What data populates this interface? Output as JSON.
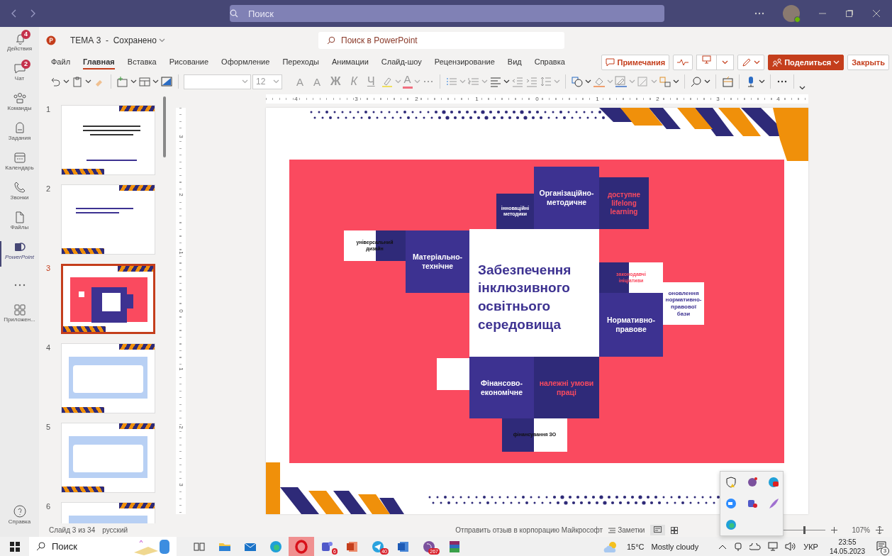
{
  "titlebar": {
    "search": {
      "placeholder": "Поиск"
    }
  },
  "rail": {
    "items": [
      {
        "label": "Действия",
        "badge": "4",
        "selected": false
      },
      {
        "label": "Чат",
        "badge": "2",
        "selected": false
      },
      {
        "label": "Команды",
        "selected": false
      },
      {
        "label": "Задания",
        "selected": false
      },
      {
        "label": "Календарь",
        "selected": false
      },
      {
        "label": "Звонки",
        "selected": false
      },
      {
        "label": "Файлы",
        "selected": false
      },
      {
        "label": "PowerPoint",
        "selected": true
      },
      {
        "label": "Приложен...",
        "selected": false
      }
    ],
    "help": "Справка"
  },
  "header": {
    "document_title": "ТЕМА 3  -  Сохранено",
    "search": {
      "placeholder": "Поиск в PowerPoint"
    }
  },
  "tabs": [
    {
      "label": "Файл",
      "selected": false
    },
    {
      "label": "Главная",
      "selected": true
    },
    {
      "label": "Вставка",
      "selected": false
    },
    {
      "label": "Рисование",
      "selected": false
    },
    {
      "label": "Оформление",
      "selected": false
    },
    {
      "label": "Переходы",
      "selected": false
    },
    {
      "label": "Анимации",
      "selected": false
    },
    {
      "label": "Слайд-шоу",
      "selected": false
    },
    {
      "label": "Рецензирование",
      "selected": false
    },
    {
      "label": "Вид",
      "selected": false
    },
    {
      "label": "Справка",
      "selected": false
    }
  ],
  "actions": {
    "comments": "Примечания",
    "share": "Поделиться",
    "close": "Закрыть"
  },
  "toolbar": {
    "font_size": "12",
    "format_buttons": [
      {
        "kind": "grow",
        "label": "A"
      },
      {
        "kind": "shrink",
        "label": "A"
      },
      {
        "kind": "bold",
        "label": "Ж"
      },
      {
        "kind": "italic",
        "label": "К"
      },
      {
        "kind": "underline",
        "label": "Ч"
      }
    ],
    "font_color": "A"
  },
  "thumbnails": [
    {
      "number": "1",
      "kind": "title",
      "selected": false
    },
    {
      "number": "2",
      "kind": "subtitle",
      "selected": false
    },
    {
      "number": "3",
      "kind": "diagram",
      "selected": true
    },
    {
      "number": "4",
      "kind": "card",
      "selected": false
    },
    {
      "number": "5",
      "kind": "card",
      "selected": false
    },
    {
      "number": "6",
      "kind": "card",
      "selected": false
    }
  ],
  "rulers": {
    "horizontal": [
      "4",
      "3",
      "2",
      "1",
      "0",
      "1",
      "2",
      "3",
      "4"
    ],
    "vertical": [
      "3",
      "2",
      "1",
      "0",
      "1",
      "2",
      "3"
    ]
  },
  "slide": {
    "center": "Забезпечення інклюзивного освітнього середовища",
    "blocks": [
      {
        "kind": "accent-white",
        "text": "інноваційні методики"
      },
      {
        "kind": "primary",
        "text": "Організаційно-методичне"
      },
      {
        "kind": "accent",
        "text": "доступне lifelong learning"
      },
      {
        "kind": "split",
        "text": "універсальний дизайн"
      },
      {
        "kind": "primary",
        "text": "Матеріально-технічне"
      },
      {
        "kind": "split-accent",
        "text": "законодавчі ініціативи"
      },
      {
        "kind": "light",
        "text": "оновлення нормативно-правової бази"
      },
      {
        "kind": "primary",
        "text": "Нормативно-правове"
      },
      {
        "kind": "primary",
        "text": "Фінансово-економічне"
      },
      {
        "kind": "accent",
        "text": "належні умови праці"
      },
      {
        "kind": "split-rev",
        "text": "фінансування ЗО"
      }
    ]
  },
  "status": {
    "slide_info": "Слайд 3 из 34",
    "language": "русский",
    "feedback": "Отправить отзыв в корпорацию Майкрософт",
    "notes": "Заметки",
    "zoom": "107%",
    "zoom_slider": {
      "level": 0.5
    }
  },
  "taskbar": {
    "search": {
      "placeholder": "Поиск"
    },
    "apps": [
      {
        "highlighted": false
      },
      {
        "highlighted": false
      },
      {
        "highlighted": false
      },
      {
        "highlighted": false
      },
      {
        "highlighted": true
      },
      {
        "highlighted": false,
        "badge": "6"
      },
      {
        "highlighted": false
      },
      {
        "highlighted": false,
        "badge": "40"
      },
      {
        "highlighted": false
      },
      {
        "highlighted": false,
        "badge": "267"
      },
      {
        "highlighted": false
      }
    ],
    "weather": {
      "temperature": "15°C",
      "condition": "Mostly cloudy"
    },
    "language": "УКР",
    "time": "23:55",
    "date": "14.05.2023",
    "notifications": "3"
  }
}
